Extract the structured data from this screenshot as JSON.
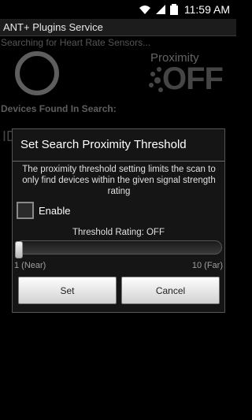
{
  "status_bar": {
    "time": "11:59 AM"
  },
  "app": {
    "title": "ANT+ Plugins Service"
  },
  "background": {
    "searching_text": "Searching for Heart Rate Sensors...",
    "proximity_label": "Proximity",
    "proximity_state": "OFF",
    "devices_found": "Devices Found In Search:",
    "partial_text": "ID"
  },
  "dialog": {
    "title": "Set Search Proximity Threshold",
    "description": "The proximity threshold setting limits the scan to only find devices within the given signal strength rating",
    "enable_label": "Enable",
    "enable_checked": false,
    "threshold_label": "Threshold Rating: OFF",
    "slider_value": 0,
    "slider_min_label": "1 (Near)",
    "slider_max_label": "10 (Far)",
    "set_button": "Set",
    "cancel_button": "Cancel"
  }
}
